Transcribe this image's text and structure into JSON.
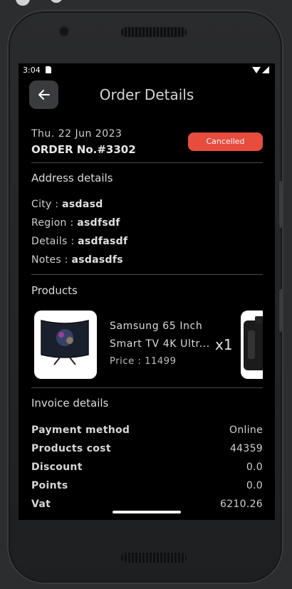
{
  "status_bar": {
    "time": "3:04"
  },
  "header": {
    "title": "Order Details"
  },
  "order": {
    "date": "Thu. 22 Jun 2023",
    "number": "ORDER No.#3302",
    "status": "Cancelled",
    "status_color": "#e84c3d"
  },
  "address": {
    "section_title": "Address details",
    "city_label": "City : ",
    "city": "asdasd",
    "region_label": "Region : ",
    "region": "asdfsdf",
    "details_label": "Details : ",
    "details": "asdfasdf",
    "notes_label": "Notes : ",
    "notes": "asdasdfs"
  },
  "products": {
    "section_title": "Products",
    "items": [
      {
        "name_line1": "Samsung 65 Inch",
        "name_line2": "Smart TV 4K Ultr...",
        "price": "Price : 11499",
        "quantity": "x1"
      }
    ]
  },
  "invoice": {
    "section_title": "Invoice details",
    "rows": [
      {
        "label": "Payment method",
        "value": "Online"
      },
      {
        "label": "Products cost",
        "value": "44359"
      },
      {
        "label": "Discount",
        "value": "0.0"
      },
      {
        "label": "Points",
        "value": "0.0"
      },
      {
        "label": "Vat",
        "value": "6210.26"
      }
    ]
  }
}
